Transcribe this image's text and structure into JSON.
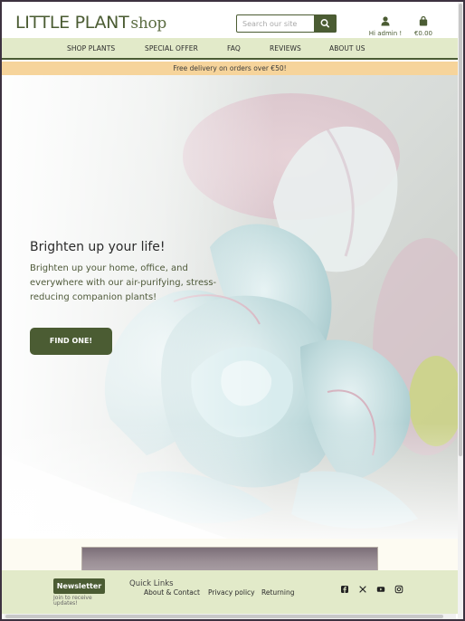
{
  "header": {
    "logo_main": "LITTLE PLANT",
    "logo_shop": "shop",
    "search_placeholder": "Search our site",
    "user_label": "Hi admin !",
    "cart_total": "€0.00"
  },
  "nav": {
    "items": [
      "SHOP PLANTS",
      "SPECIAL OFFER",
      "FAQ",
      "REVIEWS",
      "ABOUT US"
    ]
  },
  "banner": {
    "text": "Free delivery on orders over €50!"
  },
  "hero": {
    "heading": "Brighten up your life!",
    "subtext": "Brighten up your home, office, and everywhere with our air-purifying, stress-reducing companion plants!",
    "cta": "FIND ONE!"
  },
  "footer": {
    "newsletter_button": "Newsletter",
    "newsletter_note": "Join to receive updates!",
    "quick_links_title": "Quick Links",
    "links": [
      "About & Contact",
      "Privacy policy",
      "Returning"
    ],
    "social": [
      "facebook-icon",
      "x-icon",
      "youtube-icon",
      "instagram-icon"
    ]
  },
  "colors": {
    "brand_green": "#4b5c33",
    "nav_bg": "#e2eac9",
    "banner_bg": "#f6d49b"
  }
}
